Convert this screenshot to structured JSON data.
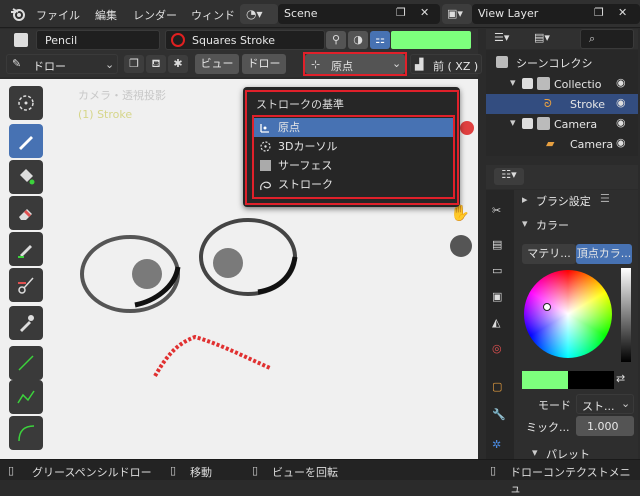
{
  "menubar": {
    "items": [
      "ファイル",
      "編集",
      "レンダー",
      "ウィンド"
    ],
    "scene": "Scene",
    "view_layer": "View Layer"
  },
  "header": {
    "object_name": "Pencil",
    "brush_name": "Squares Stroke",
    "mode": "ドロー",
    "view_btn": "ビュー",
    "draw_btn": "ドロー",
    "pivot": "原点",
    "orientation": "前 ( XZ )"
  },
  "viewport": {
    "camera_label": "カメラ・透視投影",
    "object_label": "(1) Stroke"
  },
  "dropdown": {
    "title": "ストロークの基準",
    "items": [
      "原点",
      "3Dカーソル",
      "サーフェス",
      "ストローク"
    ],
    "selected": 0
  },
  "outliner": {
    "title": "シーンコレクシ",
    "rows": [
      "Collectio",
      "Stroke",
      "Camera",
      "Camera"
    ]
  },
  "properties": {
    "brush_settings": "ブラシ設定",
    "color": "カラー",
    "material_tab": "マテリ...",
    "vertex_tab": "頂点カラ...",
    "mode_label": "モード",
    "mode_value": "スト...",
    "mix_label": "ミック...",
    "mix_value": "1.000",
    "palette": "パレット",
    "primary_color": "#7dff7d",
    "secondary_color": "#000000"
  },
  "status": {
    "left": "グリースペンシルドロー",
    "middle": "移動",
    "rotate": "ビューを回転",
    "right": "ドローコンテクストメニュ"
  },
  "colors": {
    "accent": "#4772b3",
    "highlight": "#e0202a"
  }
}
